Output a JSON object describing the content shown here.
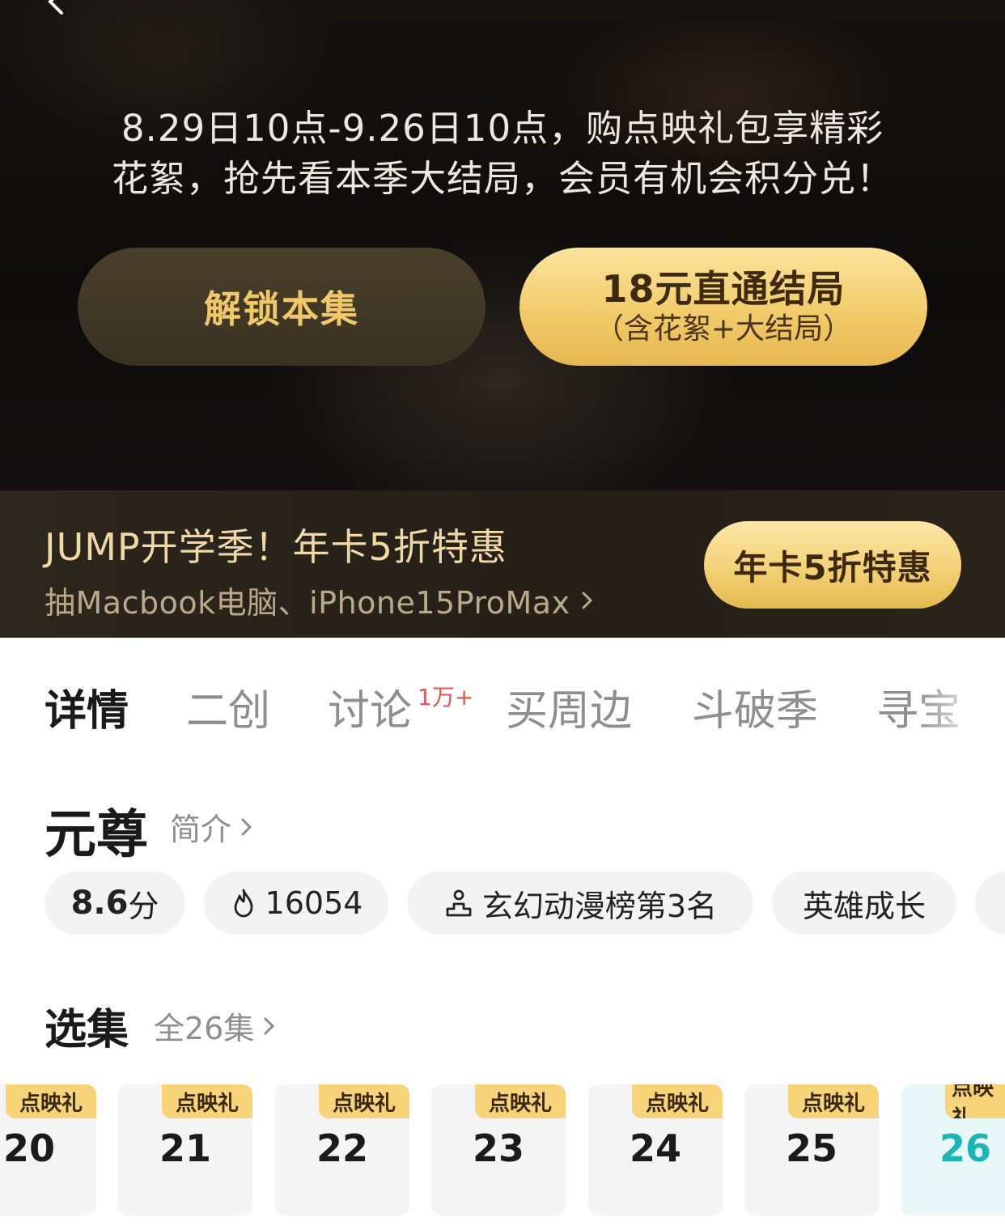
{
  "hero": {
    "line1": "8.29日10点-9.26日10点，购点映礼包享精彩",
    "line2": "花絮，抢先看本季大结局，会员有机会积分兑！",
    "unlock_label": "解锁本集",
    "finale_label": "18元直通结局",
    "finale_sub": "（含花絮+大结局）"
  },
  "banner": {
    "title": "JUMP开学季！年卡5折特惠",
    "subtitle": "抽Macbook电脑、iPhone15ProMax",
    "button": "年卡5折特惠"
  },
  "tabs": [
    {
      "label": "详情",
      "active": true
    },
    {
      "label": "二创"
    },
    {
      "label": "讨论",
      "badge": "1万+"
    },
    {
      "label": "买周边"
    },
    {
      "label": "斗破季"
    },
    {
      "label": "寻宝"
    }
  ],
  "show": {
    "title": "元尊",
    "intro": "简介"
  },
  "tags": {
    "score_value": "8.6",
    "score_unit": "分",
    "heat": "16054",
    "rank": "玄幻动漫榜第3名",
    "genre": "英雄成长"
  },
  "episodes": {
    "title": "选集",
    "all": "全26集",
    "badge": "点映礼",
    "items": [
      "20",
      "21",
      "22",
      "23",
      "24",
      "25",
      "26"
    ],
    "current": "26"
  },
  "colors": {
    "accent_gold": "#f2cc6b",
    "current_episode": "#1bb5b8",
    "badge_red": "#f0524f"
  }
}
